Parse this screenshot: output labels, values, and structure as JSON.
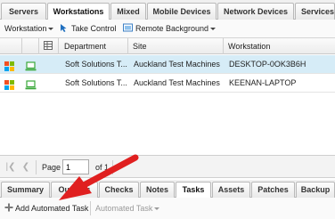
{
  "top_tabs": [
    {
      "label": "Servers",
      "active": false
    },
    {
      "label": "Workstations",
      "active": true
    },
    {
      "label": "Mixed",
      "active": false
    },
    {
      "label": "Mobile Devices",
      "active": false
    },
    {
      "label": "Network Devices",
      "active": false
    },
    {
      "label": "Services",
      "active": false
    }
  ],
  "toolbar": {
    "workstation_menu": "Workstation",
    "take_control": "Take Control",
    "remote_background": "Remote Background"
  },
  "grid": {
    "columns": [
      "Department",
      "Site",
      "Workstation"
    ],
    "rows": [
      {
        "department": "Soft Solutions T...",
        "site": "Auckland Test Machines",
        "workstation": "DESKTOP-0OK3B6H",
        "selected": true
      },
      {
        "department": "Soft Solutions T...",
        "site": "Auckland Test Machines",
        "workstation": "KEENAN-LAPTOP",
        "selected": false
      }
    ]
  },
  "pager": {
    "page_label": "Page",
    "page_value": "1",
    "of_label": "of 1"
  },
  "bottom_tabs": [
    {
      "label": "Summary",
      "active": false
    },
    {
      "label": "Outages",
      "active": false
    },
    {
      "label": "Checks",
      "active": false
    },
    {
      "label": "Notes",
      "active": false
    },
    {
      "label": "Tasks",
      "active": true
    },
    {
      "label": "Assets",
      "active": false
    },
    {
      "label": "Patches",
      "active": false
    },
    {
      "label": "Backup",
      "active": false
    }
  ],
  "bottom_toolbar": {
    "add_task": "Add Automated Task",
    "automated_task_menu": "Automated Task"
  },
  "colors": {
    "selected_row": "#d6ecf7",
    "arrow": "#e02020",
    "workstation_icon": "#3aa83a"
  },
  "icons": {
    "windows_logo": "windows-logo-icon",
    "workstation": "laptop-icon",
    "take_control": "take-control-icon",
    "remote_background": "remote-background-icon",
    "add": "plus-icon"
  }
}
